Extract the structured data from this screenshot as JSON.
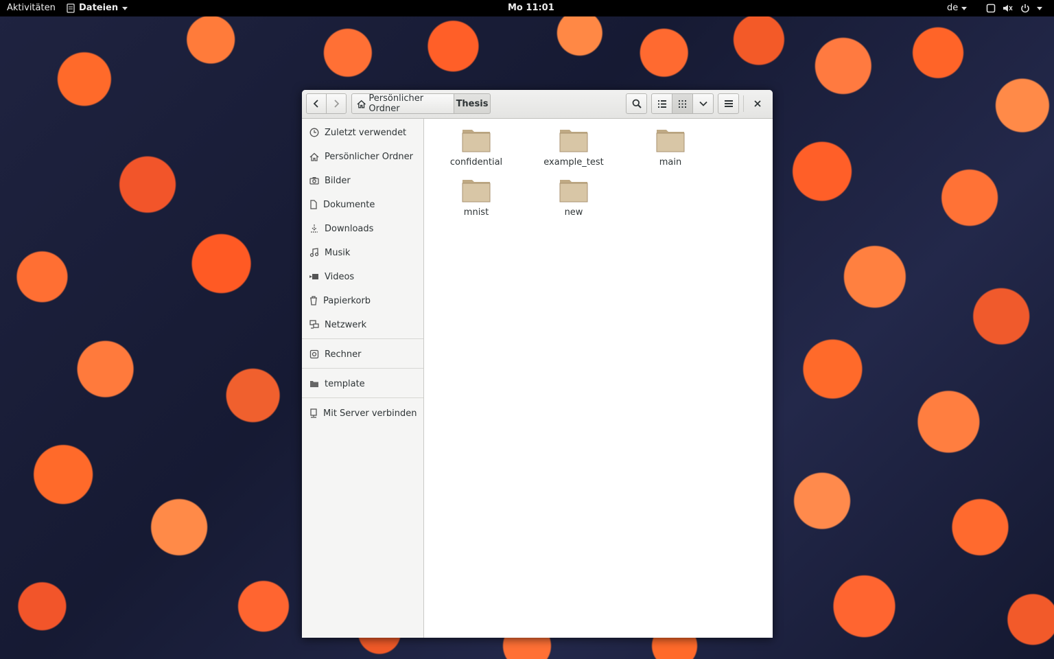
{
  "topbar": {
    "activities": "Aktivitäten",
    "app_menu": "Dateien",
    "clock": "Mo 11:01",
    "language": "de"
  },
  "headerbar": {
    "path": [
      {
        "label": "Persönlicher Ordner"
      },
      {
        "label": "Thesis"
      }
    ]
  },
  "sidebar": {
    "items": [
      {
        "label": "Zuletzt verwendet",
        "icon": "clock-icon"
      },
      {
        "label": "Persönlicher Ordner",
        "icon": "home-icon"
      },
      {
        "label": "Bilder",
        "icon": "camera-icon"
      },
      {
        "label": "Dokumente",
        "icon": "document-icon"
      },
      {
        "label": "Downloads",
        "icon": "download-icon"
      },
      {
        "label": "Musik",
        "icon": "music-icon"
      },
      {
        "label": "Videos",
        "icon": "video-icon"
      },
      {
        "label": "Papierkorb",
        "icon": "trash-icon"
      },
      {
        "label": "Netzwerk",
        "icon": "network-icon"
      }
    ],
    "devices": [
      {
        "label": "Rechner",
        "icon": "computer-icon"
      }
    ],
    "bookmarks": [
      {
        "label": "template",
        "icon": "folder-icon"
      }
    ],
    "connect": {
      "label": "Mit Server verbinden",
      "icon": "server-icon"
    }
  },
  "files": [
    {
      "name": "confidential"
    },
    {
      "name": "example_test"
    },
    {
      "name": "main"
    },
    {
      "name": "mnist"
    },
    {
      "name": "new"
    }
  ],
  "colors": {
    "folder_fill": "#d8c6a6",
    "folder_tab": "#bfa984",
    "topbar_bg": "#000000",
    "headerbar_bg": "#e8e8e7"
  }
}
